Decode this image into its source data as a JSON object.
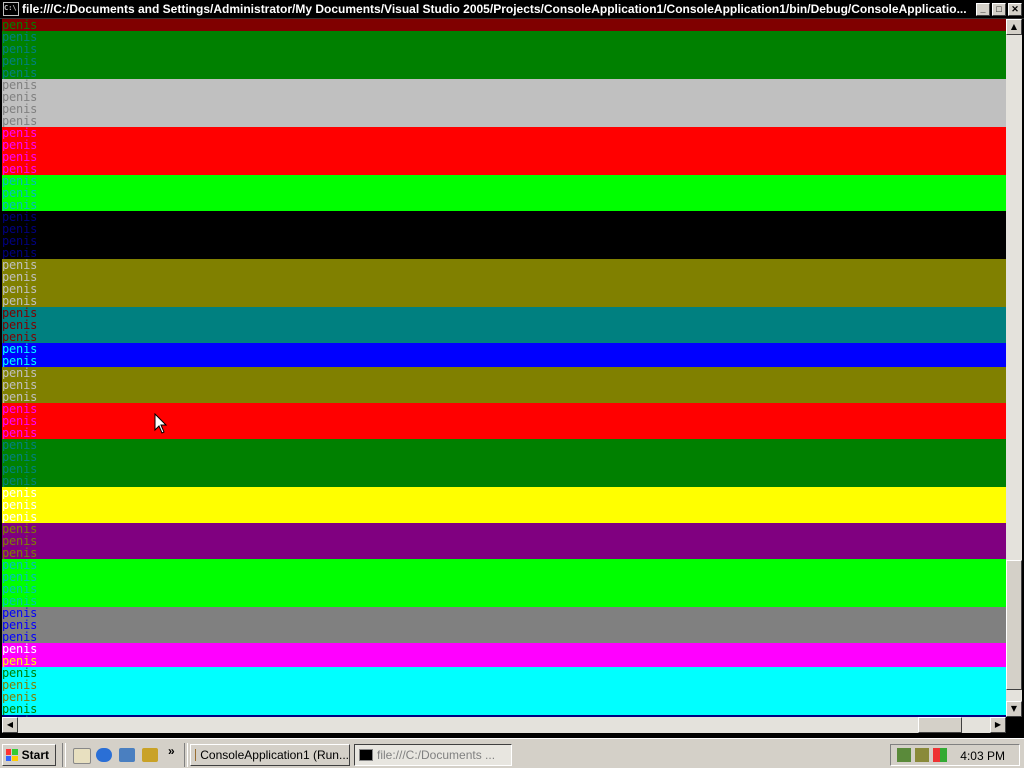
{
  "window": {
    "title": "file:///C:/Documents and Settings/Administrator/My Documents/Visual Studio 2005/Projects/ConsoleApplication1/ConsoleApplication1/bin/Debug/ConsoleApplicatio...",
    "icon_text": "C:\\"
  },
  "title_buttons": {
    "minimize": "_",
    "maximize": "□",
    "close": "✕"
  },
  "console": {
    "word": "penis",
    "rows": [
      {
        "bg": "#800000",
        "fg": "#008000"
      },
      {
        "bg": "#008000",
        "fg": "#008080"
      },
      {
        "bg": "#008000",
        "fg": "#008080"
      },
      {
        "bg": "#008000",
        "fg": "#008080"
      },
      {
        "bg": "#008000",
        "fg": "#008080"
      },
      {
        "bg": "#c0c0c0",
        "fg": "#808080"
      },
      {
        "bg": "#c0c0c0",
        "fg": "#808080"
      },
      {
        "bg": "#c0c0c0",
        "fg": "#808080"
      },
      {
        "bg": "#c0c0c0",
        "fg": "#808080"
      },
      {
        "bg": "#ff0000",
        "fg": "#ff00ff"
      },
      {
        "bg": "#ff0000",
        "fg": "#ff00ff"
      },
      {
        "bg": "#ff0000",
        "fg": "#ff00ff"
      },
      {
        "bg": "#ff0000",
        "fg": "#ff00ff"
      },
      {
        "bg": "#00ff00",
        "fg": "#00c0c0"
      },
      {
        "bg": "#00ff00",
        "fg": "#00c0c0"
      },
      {
        "bg": "#00ff00",
        "fg": "#00c0c0"
      },
      {
        "bg": "#000000",
        "fg": "#000080"
      },
      {
        "bg": "#000000",
        "fg": "#000080"
      },
      {
        "bg": "#000000",
        "fg": "#000080"
      },
      {
        "bg": "#000000",
        "fg": "#000080"
      },
      {
        "bg": "#808000",
        "fg": "#c0c0c0"
      },
      {
        "bg": "#808000",
        "fg": "#c0c0c0"
      },
      {
        "bg": "#808000",
        "fg": "#c0c0c0"
      },
      {
        "bg": "#808000",
        "fg": "#c0c0c0"
      },
      {
        "bg": "#008080",
        "fg": "#800000"
      },
      {
        "bg": "#008080",
        "fg": "#800000"
      },
      {
        "bg": "#008080",
        "fg": "#800000"
      },
      {
        "bg": "#0000ff",
        "fg": "#00ffff"
      },
      {
        "bg": "#0000ff",
        "fg": "#00ffff"
      },
      {
        "bg": "#808000",
        "fg": "#c0c0c0"
      },
      {
        "bg": "#808000",
        "fg": "#c0c0c0"
      },
      {
        "bg": "#808000",
        "fg": "#c0c0c0"
      },
      {
        "bg": "#ff0000",
        "fg": "#ff00ff"
      },
      {
        "bg": "#ff0000",
        "fg": "#ff00ff"
      },
      {
        "bg": "#ff0000",
        "fg": "#ff00ff"
      },
      {
        "bg": "#008000",
        "fg": "#008080"
      },
      {
        "bg": "#008000",
        "fg": "#008080"
      },
      {
        "bg": "#008000",
        "fg": "#008080"
      },
      {
        "bg": "#008000",
        "fg": "#008080"
      },
      {
        "bg": "#ffff00",
        "fg": "#ffffff"
      },
      {
        "bg": "#ffff00",
        "fg": "#ffffff"
      },
      {
        "bg": "#ffff00",
        "fg": "#ffffff"
      },
      {
        "bg": "#800080",
        "fg": "#808000"
      },
      {
        "bg": "#800080",
        "fg": "#808000"
      },
      {
        "bg": "#800080",
        "fg": "#808000"
      },
      {
        "bg": "#00ff00",
        "fg": "#00c0c0"
      },
      {
        "bg": "#00ff00",
        "fg": "#00c0c0"
      },
      {
        "bg": "#00ff00",
        "fg": "#00c0c0"
      },
      {
        "bg": "#00ff00",
        "fg": "#00c0c0"
      },
      {
        "bg": "#808080",
        "fg": "#0000ff"
      },
      {
        "bg": "#808080",
        "fg": "#0000ff"
      },
      {
        "bg": "#808080",
        "fg": "#0000ff"
      },
      {
        "bg": "#ff00ff",
        "fg": "#ffffff"
      },
      {
        "bg": "#ff00ff",
        "fg": "#ffff00"
      },
      {
        "bg": "#00ffff",
        "fg": "#008000"
      },
      {
        "bg": "#00ffff",
        "fg": "#808000"
      },
      {
        "bg": "#00ffff",
        "fg": "#808000"
      },
      {
        "bg": "#00ffff",
        "fg": "#008000"
      },
      {
        "bg": "#000080",
        "fg": "#008080"
      }
    ]
  },
  "scrollbars": {
    "up": "▲",
    "down": "▼",
    "left": "◀",
    "right": "▶",
    "vertical_position": 0.98,
    "horizontal_position": 0.97
  },
  "taskbar": {
    "start_label": "Start",
    "quicklaunch_more": "»",
    "tasks": [
      {
        "label": "ConsoleApplication1 (Run...",
        "active": false
      },
      {
        "label": "file:///C:/Documents ...",
        "active": true
      }
    ],
    "clock": "4:03 PM"
  }
}
